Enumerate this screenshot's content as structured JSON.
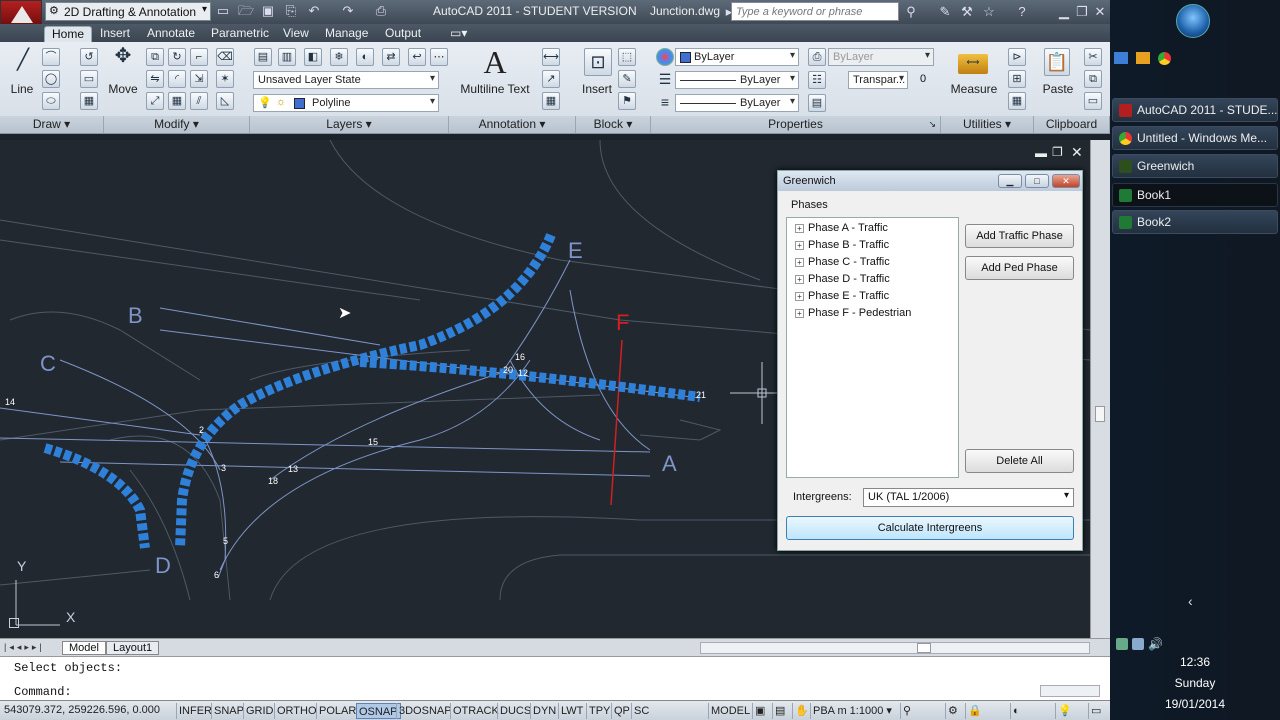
{
  "titlebar": {
    "workspace": "2D Drafting & Annotation",
    "title": "AutoCAD 2011 - STUDENT VERSION    Junction.dwg",
    "search_placeholder": "Type a keyword or phrase"
  },
  "tabs": [
    "Home",
    "Insert",
    "Annotate",
    "Parametric",
    "View",
    "Manage",
    "Output"
  ],
  "ribbon": {
    "draw_panel": "Draw",
    "modify_panel": "Modify",
    "layers_panel": "Layers",
    "annotation_panel": "Annotation",
    "block_panel": "Block",
    "properties_panel": "Properties",
    "utilities_panel": "Utilities",
    "clipboard_panel": "Clipboard",
    "line_label": "Line",
    "move_label": "Move",
    "multiline_text_label": "Multiline Text",
    "insert_label": "Insert",
    "measure_label": "Measure",
    "paste_label": "Paste",
    "layer_state": "Unsaved Layer State",
    "layer_name": "Polyline",
    "color_bylayer": "ByLayer",
    "linetype_bylayer": "ByLayer",
    "lineweight_bylayer": "ByLayer",
    "plotstyle_bylayer": "ByLayer",
    "transparency_label": "Transpar...",
    "transparency_value": "0"
  },
  "drawing": {
    "labels": [
      "A",
      "B",
      "C",
      "D",
      "E",
      "F"
    ],
    "numbers": [
      "14",
      "15",
      "13",
      "18",
      "3",
      "5",
      "6",
      "2",
      "16",
      "12",
      "21",
      "20"
    ],
    "ucs_x": "X",
    "ucs_y": "Y"
  },
  "layout_tabs": [
    "Model",
    "Layout1"
  ],
  "command": {
    "line1": "Select objects:",
    "line2": "Command:"
  },
  "status": {
    "coords": "543079.372, 259226.596, 0.000",
    "toggles": [
      "INFER",
      "SNAP",
      "GRID",
      "ORTHO",
      "POLAR",
      "OSNAP",
      "3DOSNAP",
      "OTRACK",
      "DUCS",
      "DYN",
      "LWT",
      "TPY",
      "QP",
      "SC"
    ],
    "model": "MODEL",
    "scale": "PBA m 1:1000"
  },
  "greenwich": {
    "title": "Greenwich",
    "phases_label": "Phases",
    "phases": [
      "Phase A - Traffic",
      "Phase B - Traffic",
      "Phase C - Traffic",
      "Phase D - Traffic",
      "Phase E - Traffic",
      "Phase F - Pedestrian"
    ],
    "add_traffic": "Add Traffic Phase",
    "add_ped": "Add Ped Phase",
    "delete_all": "Delete All",
    "intergreens_label": "Intergreens:",
    "intergreens_value": "UK (TAL 1/2006)",
    "calculate": "Calculate Intergreens"
  },
  "taskbar": {
    "items": [
      "AutoCAD 2011 - STUDE...",
      "Untitled - Windows Me...",
      "Greenwich",
      "Book1",
      "Book2"
    ],
    "time": "12:36",
    "day": "Sunday",
    "date": "19/01/2014"
  }
}
